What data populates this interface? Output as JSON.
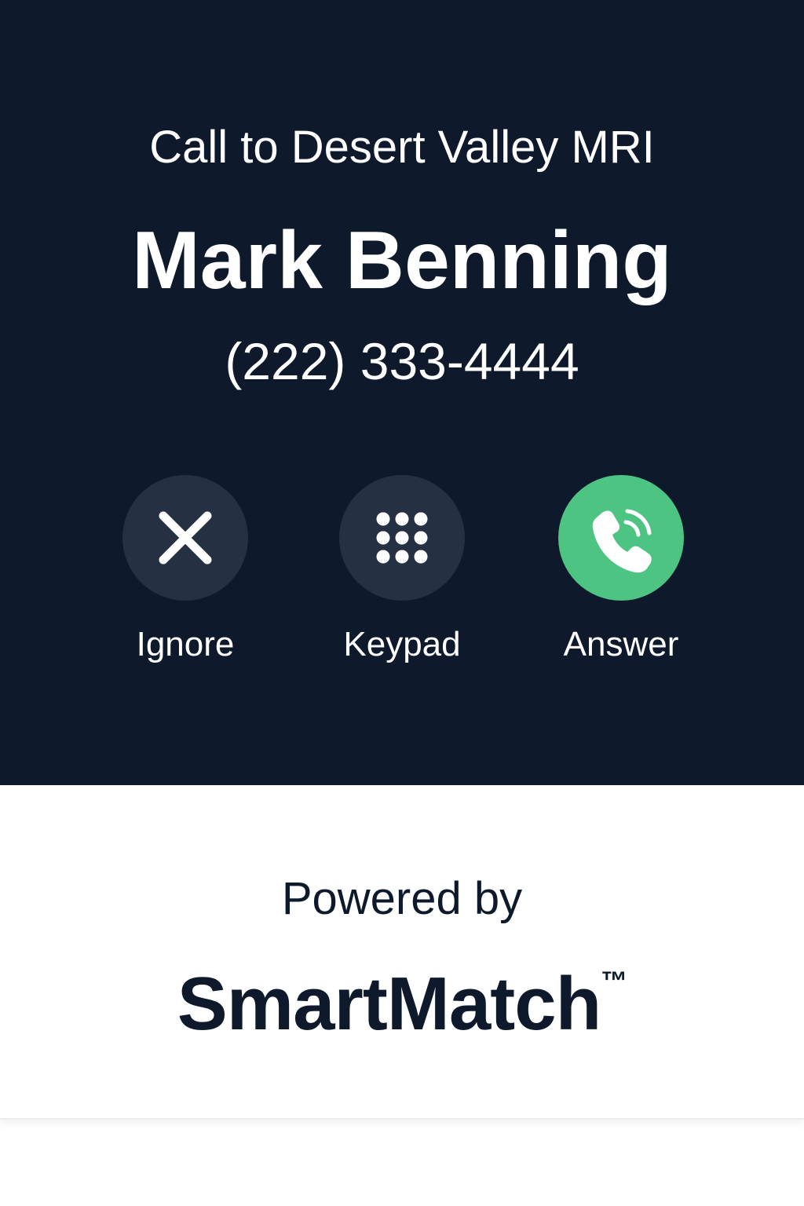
{
  "call": {
    "destination": "Call to Desert Valley MRI",
    "caller_name": "Mark Benning",
    "caller_number": "(222) 333-4444"
  },
  "actions": [
    {
      "label": "Ignore",
      "icon": "close-icon"
    },
    {
      "label": "Keypad",
      "icon": "keypad-icon"
    },
    {
      "label": "Answer",
      "icon": "phone-ringing-icon"
    }
  ],
  "branding": {
    "powered_by": "Powered by",
    "name": "SmartMatch",
    "trademark": "™"
  },
  "colors": {
    "background_dark": "#0e1a2b",
    "button_dark": "#253142",
    "answer_green": "#4ec483",
    "text_light": "#ffffff",
    "text_dark": "#0e1a2b"
  }
}
